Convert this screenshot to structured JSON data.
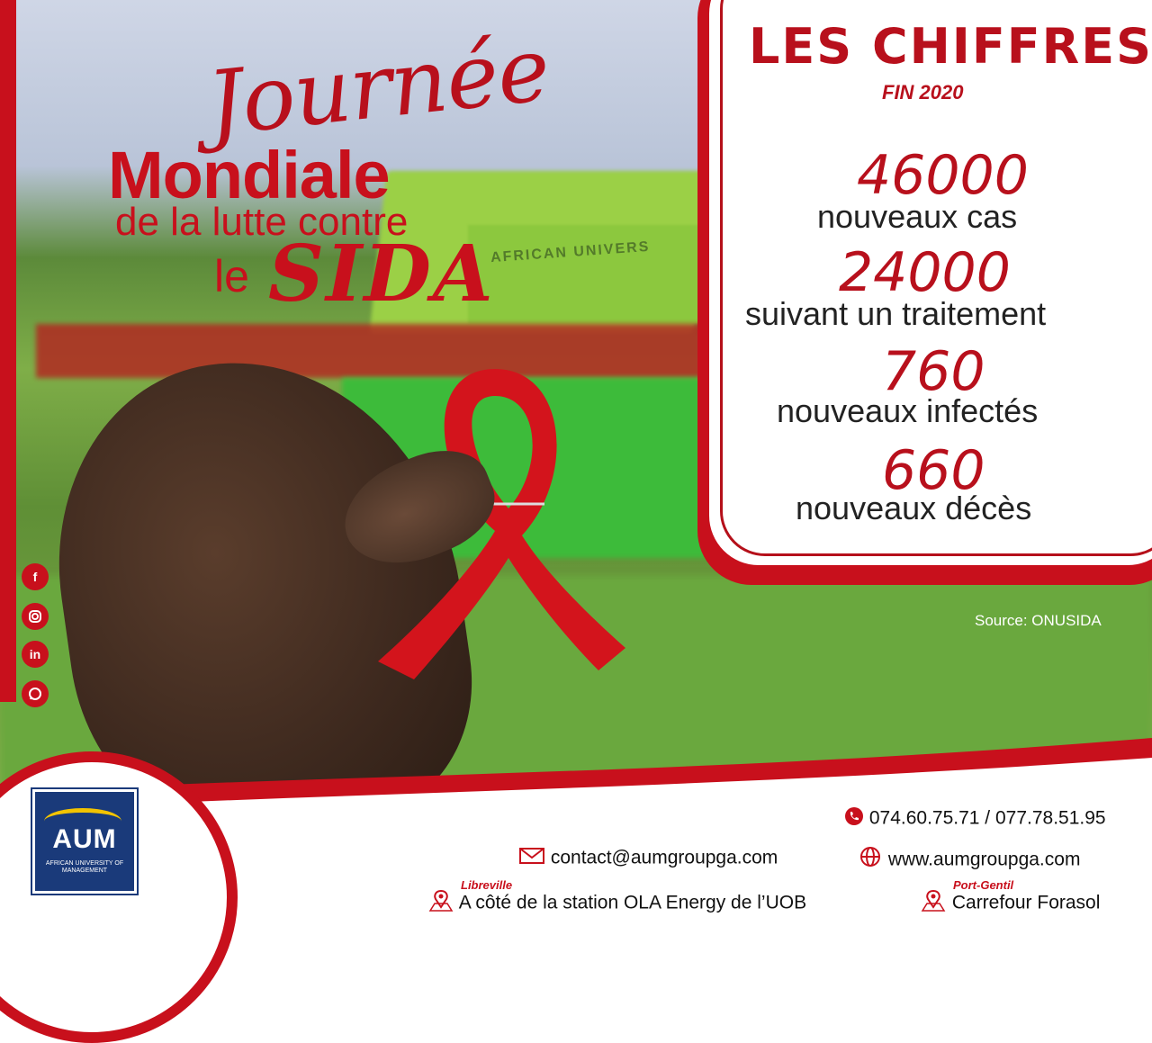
{
  "title": {
    "line1": "Journée",
    "line2": "Mondiale",
    "line3": "de la lutte contre",
    "line4_le": "le",
    "line4_sida": "SIDA"
  },
  "figures": {
    "heading": "LES CHIFFRES*",
    "subheading": "FIN 2020",
    "stats": [
      {
        "value": "46000",
        "label": "nouveaux cas"
      },
      {
        "value": "24000",
        "label": "suivant un traitement"
      },
      {
        "value": "760",
        "label": "nouveaux infectés"
      },
      {
        "value": "660",
        "label": "nouveaux décès"
      }
    ],
    "source": "Source: ONUSIDA"
  },
  "social": [
    "facebook-icon",
    "instagram-icon",
    "linkedin-icon",
    "whatsapp-icon"
  ],
  "logo": {
    "acronym": "AUM",
    "fullname": "AFRICAN UNIVERSITY OF MANAGEMENT"
  },
  "photo": {
    "sign_text": "AFRICAN UNIVERS"
  },
  "contact": {
    "phones": "074.60.75.71 / 077.78.51.95",
    "email": "contact@aumgroupga.com",
    "website": "www.aumgroupga.com",
    "loc1_city": "Libreville",
    "loc1_address": "A côté de la station OLA Energy de l’UOB",
    "loc2_city": "Port-Gentil",
    "loc2_address": "Carrefour Forasol"
  },
  "colors": {
    "accent": "#c8101c",
    "logo_bg": "#1a3a7a",
    "logo_yellow": "#f2c300"
  }
}
